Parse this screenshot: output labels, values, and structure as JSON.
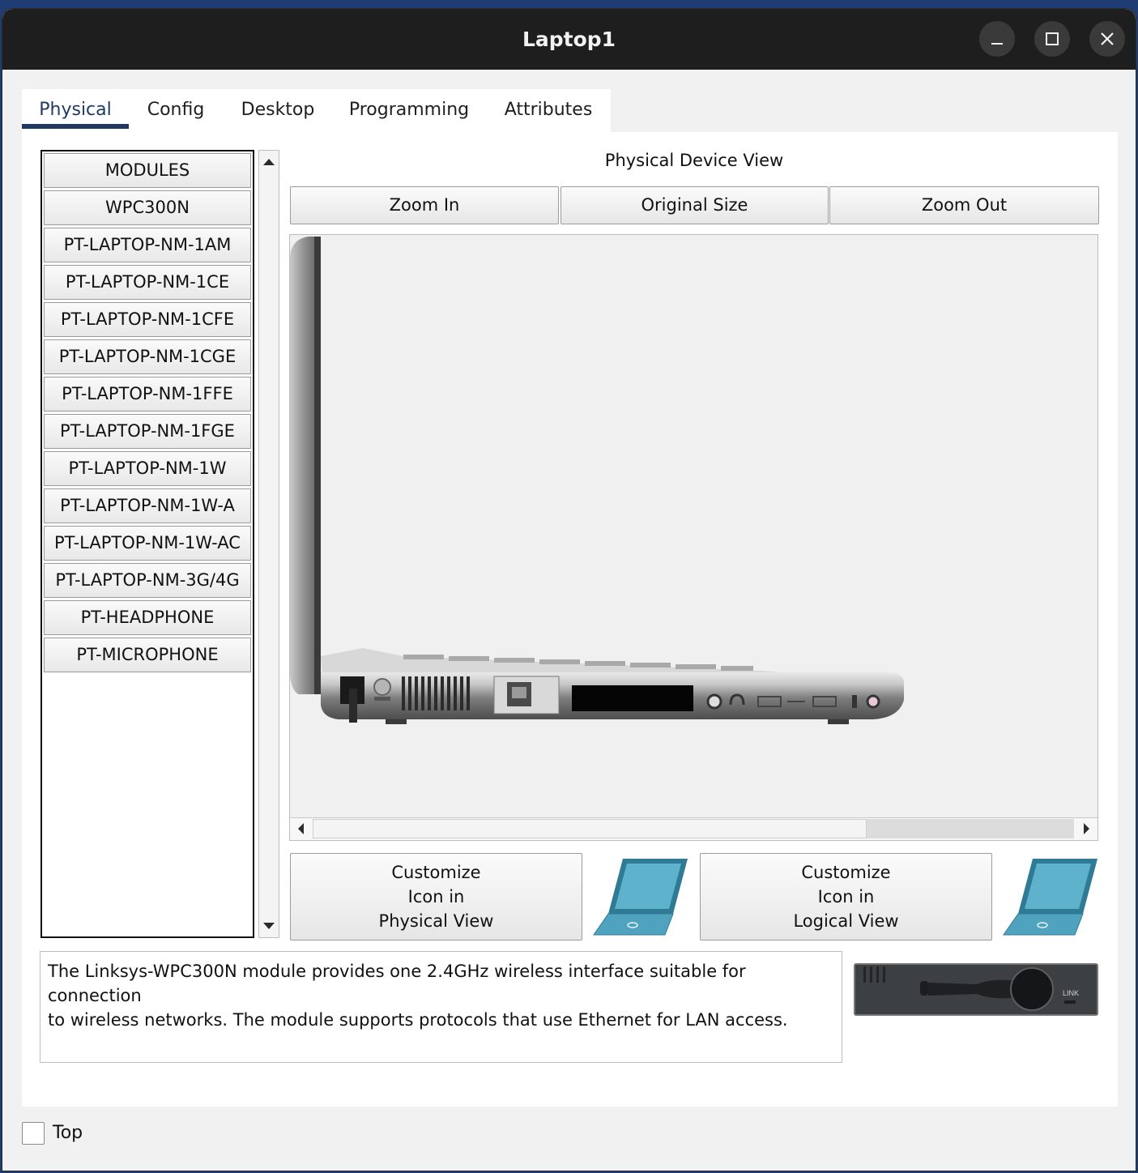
{
  "window": {
    "title": "Laptop1"
  },
  "tabs": [
    {
      "label": "Physical",
      "active": true
    },
    {
      "label": "Config"
    },
    {
      "label": "Desktop"
    },
    {
      "label": "Programming"
    },
    {
      "label": "Attributes"
    }
  ],
  "modules": {
    "items": [
      "MODULES",
      "WPC300N",
      "PT-LAPTOP-NM-1AM",
      "PT-LAPTOP-NM-1CE",
      "PT-LAPTOP-NM-1CFE",
      "PT-LAPTOP-NM-1CGE",
      "PT-LAPTOP-NM-1FFE",
      "PT-LAPTOP-NM-1FGE",
      "PT-LAPTOP-NM-1W",
      "PT-LAPTOP-NM-1W-A",
      "PT-LAPTOP-NM-1W-AC",
      "PT-LAPTOP-NM-3G/4G",
      "PT-HEADPHONE",
      "PT-MICROPHONE"
    ]
  },
  "device_view": {
    "label": "Physical Device View",
    "zoom_in": "Zoom In",
    "original_size": "Original Size",
    "zoom_out": "Zoom Out"
  },
  "customize": {
    "physical": [
      "Customize",
      "Icon in",
      "Physical View"
    ],
    "logical": [
      "Customize",
      "Icon in",
      "Logical View"
    ]
  },
  "description": {
    "line1": "The Linksys-WPC300N module provides one 2.4GHz wireless interface suitable for connection",
    "line2": "to wireless networks. The module supports protocols that use Ethernet for LAN access."
  },
  "module_image": {
    "label": "LINK"
  },
  "footer": {
    "top_label": "Top",
    "top_checked": false
  },
  "colors": {
    "titlebar": "#1e1e1e",
    "tab_underline": "#1f3a5f",
    "laptop_icon": "#4fa3bf"
  }
}
